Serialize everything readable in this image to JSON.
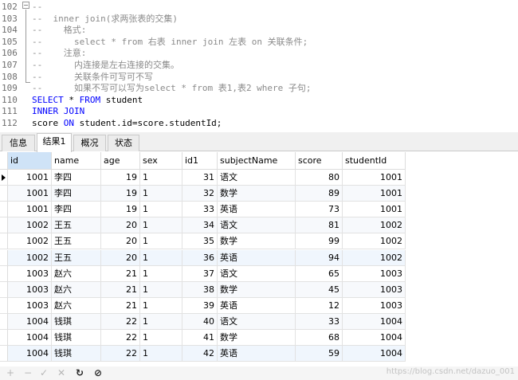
{
  "editor": {
    "lines": [
      {
        "num": "102",
        "text": "--",
        "kind": "cmt"
      },
      {
        "num": "103",
        "text": "--  inner join(求两张表的交集)",
        "kind": "cmt"
      },
      {
        "num": "104",
        "text": "--    格式:",
        "kind": "cmt"
      },
      {
        "num": "105",
        "text": "--      select * from 右表 inner join 左表 on 关联条件;",
        "kind": "cmt"
      },
      {
        "num": "106",
        "text": "--    注意:",
        "kind": "cmt"
      },
      {
        "num": "107",
        "text": "--      内连接是左右连接的交集。",
        "kind": "cmt"
      },
      {
        "num": "108",
        "text": "--      关联条件可写可不写",
        "kind": "cmt"
      },
      {
        "num": "109",
        "text": "--      如果不写可以写为select * from 表1,表2 where 子句;",
        "kind": "cmt"
      },
      {
        "num": "110",
        "segments": [
          {
            "t": "SELECT",
            "k": "kw"
          },
          {
            "t": " * ",
            "k": "plain"
          },
          {
            "t": "FROM",
            "k": "kw"
          },
          {
            "t": " student",
            "k": "plain"
          }
        ]
      },
      {
        "num": "111",
        "segments": [
          {
            "t": "INNER JOIN",
            "k": "kw"
          }
        ]
      },
      {
        "num": "112",
        "segments": [
          {
            "t": "score ",
            "k": "plain"
          },
          {
            "t": "ON",
            "k": "kw"
          },
          {
            "t": " student.id=score.studentId;",
            "k": "plain"
          }
        ]
      }
    ]
  },
  "tabs": [
    {
      "label": "信息",
      "active": false
    },
    {
      "label": "结果1",
      "active": true
    },
    {
      "label": "概况",
      "active": false
    },
    {
      "label": "状态",
      "active": false
    }
  ],
  "grid": {
    "columns": [
      "id",
      "name",
      "age",
      "sex",
      "id1",
      "subjectName",
      "score",
      "studentId"
    ],
    "rows": [
      [
        "1001",
        "李四",
        "19",
        "1",
        "31",
        "语文",
        "80",
        "1001"
      ],
      [
        "1001",
        "李四",
        "19",
        "1",
        "32",
        "数学",
        "89",
        "1001"
      ],
      [
        "1001",
        "李四",
        "19",
        "1",
        "33",
        "英语",
        "73",
        "1001"
      ],
      [
        "1002",
        "王五",
        "20",
        "1",
        "34",
        "语文",
        "81",
        "1002"
      ],
      [
        "1002",
        "王五",
        "20",
        "1",
        "35",
        "数学",
        "99",
        "1002"
      ],
      [
        "1002",
        "王五",
        "20",
        "1",
        "36",
        "英语",
        "94",
        "1002"
      ],
      [
        "1003",
        "赵六",
        "21",
        "1",
        "37",
        "语文",
        "65",
        "1003"
      ],
      [
        "1003",
        "赵六",
        "21",
        "1",
        "38",
        "数学",
        "45",
        "1003"
      ],
      [
        "1003",
        "赵六",
        "21",
        "1",
        "39",
        "英语",
        "12",
        "1003"
      ],
      [
        "1004",
        "钱琪",
        "22",
        "1",
        "40",
        "语文",
        "33",
        "1004"
      ],
      [
        "1004",
        "钱琪",
        "22",
        "1",
        "41",
        "数学",
        "68",
        "1004"
      ],
      [
        "1004",
        "钱琪",
        "22",
        "1",
        "42",
        "英语",
        "59",
        "1004"
      ]
    ]
  },
  "toolbar": {
    "buttons": [
      {
        "icon": "plus-icon",
        "glyph": "+",
        "enabled": false
      },
      {
        "icon": "minus-icon",
        "glyph": "−",
        "enabled": false
      },
      {
        "icon": "check-icon",
        "glyph": "✓",
        "enabled": false
      },
      {
        "icon": "cancel-icon",
        "glyph": "✕",
        "enabled": false
      },
      {
        "icon": "refresh-icon",
        "glyph": "↻",
        "enabled": true
      },
      {
        "icon": "stop-icon",
        "glyph": "⊘",
        "enabled": true
      }
    ],
    "watermark": "https://blog.csdn.net/dazuo_001"
  }
}
